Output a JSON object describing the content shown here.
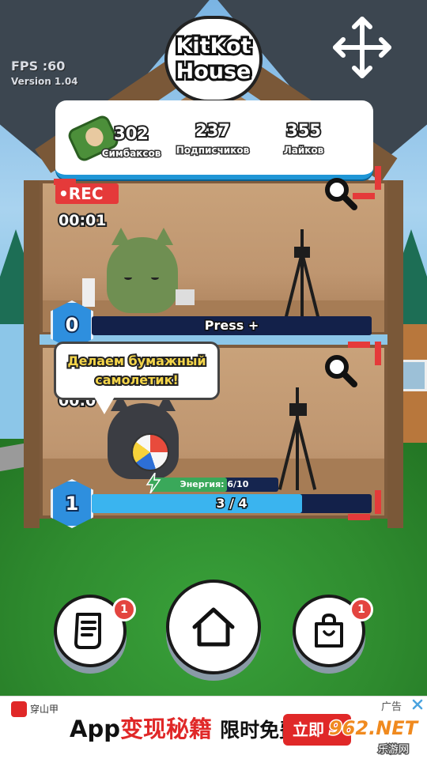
{
  "hud": {
    "fps": "FPS :60",
    "version": "Version 1.04",
    "logo_line1": "KitKot",
    "logo_line2": "House"
  },
  "stats": {
    "money_value": "302",
    "money_label": "Симбаксов",
    "subscribers_value": "237",
    "subscribers_label": "Подписчиков",
    "likes_value": "355",
    "likes_label": "Лайков"
  },
  "room1": {
    "rec_label": "•REC",
    "timer": "00:01",
    "level": "0",
    "bar_text": "Press +",
    "bar_fraction": 0
  },
  "room2": {
    "speech_line1": "Делаем бумажный",
    "speech_line2": "самолетик!",
    "timer_partial": "00:0",
    "level": "1",
    "bar_text": "3 / 4",
    "bar_fraction": 0.75,
    "energy_text": "Энергия: 6/10",
    "energy_fraction": 0.6
  },
  "bottom_nav": {
    "left_badge": "1",
    "right_badge": "1",
    "left_icon": "receipt-icon",
    "center_icon": "home-icon",
    "right_icon": "shopping-bag-icon"
  },
  "ad": {
    "close_label": "广告",
    "brand_text": "穿山甲",
    "text_prefix": "App",
    "text_highlight": "变现秘籍",
    "text_suffix": "限时免费",
    "cta": "立即",
    "watermark_top": "962.NET",
    "watermark_bottom": "乐游网"
  },
  "colors": {
    "accent_blue": "#3ab4ef",
    "rec_red": "#e53a3a",
    "badge_red": "#e3443f",
    "speech_yellow": "#f4d54a"
  }
}
